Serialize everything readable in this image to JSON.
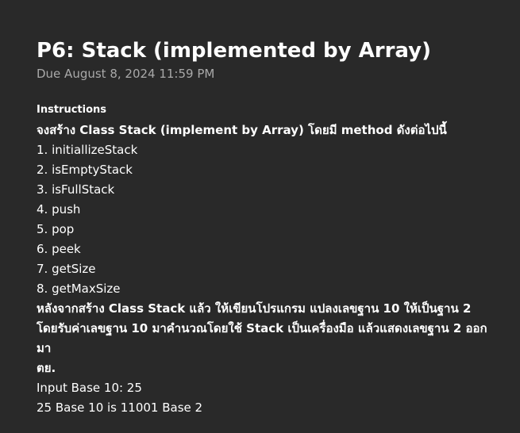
{
  "assignment": {
    "title": "P6: Stack (implemented by Array)",
    "due": "Due August 8, 2024 11:59 PM"
  },
  "instructions": {
    "label": "Instructions",
    "lines": [
      "จงสร้าง Class Stack (implement by Array) โดยมี method ดังต่อไปนี้",
      "1. initiallizeStack",
      "2. isEmptyStack",
      "3. isFullStack",
      "4. push",
      "5. pop",
      "6. peek",
      "7. getSize",
      "8. getMaxSize",
      "หลังจากสร้าง Class Stack แล้ว ให้เขียนโปรแกรม แปลงเลขฐาน 10 ให้เป็นฐาน 2",
      "โดยรับค่าเลขฐาน 10 มาคำนวณโดยใช้ Stack เป็นเครื่องมือ แล้วแสดงเลขฐาน 2 ออก",
      "มา",
      "ตย.",
      "Input Base 10: 25",
      "25 Base 10 is 11001 Base 2"
    ]
  }
}
